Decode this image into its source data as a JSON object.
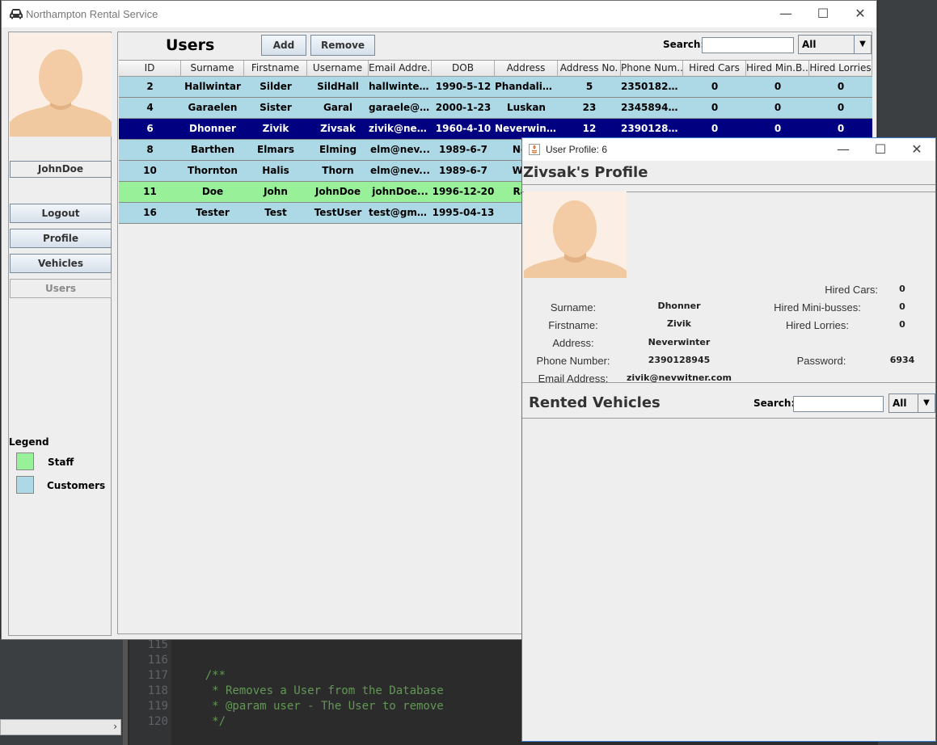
{
  "main_window": {
    "title": "Northampton Rental Service",
    "minimize": "—",
    "maximize": "☐",
    "close": "✕"
  },
  "sidebar": {
    "username": "JohnDoe",
    "buttons": {
      "logout": "Logout",
      "profile": "Profile",
      "vehicles": "Vehicles",
      "users": "Users"
    },
    "legend": {
      "title": "Legend",
      "staff_label": "Staff",
      "staff_color": "#98f098",
      "customers_label": "Customers",
      "customers_color": "#add8e6"
    }
  },
  "users_panel": {
    "title": "Users",
    "add_label": "Add",
    "remove_label": "Remove",
    "search_label": "Search:",
    "search_value": "",
    "filter_value": "All",
    "columns": [
      "ID",
      "Surname",
      "Firstname",
      "Username",
      "Email Addre...",
      "DOB",
      "Address",
      "Address No.",
      "Phone Num...",
      "Hired Cars",
      "Hired Min.B...",
      "Hired Lorries"
    ],
    "rows": [
      {
        "cells": [
          "2",
          "Hallwintar",
          "Silder",
          "SildHall",
          "hallwinter...",
          "1990-5-12",
          "Phandalin St",
          "5",
          "2350182948",
          "0",
          "0",
          "0"
        ],
        "type": "customer",
        "selected": false
      },
      {
        "cells": [
          "4",
          "Garaelen",
          "Sister",
          "Garal",
          "garaele@n...",
          "2000-1-23",
          "Luskan",
          "23",
          "2345894589",
          "0",
          "0",
          "0"
        ],
        "type": "customer",
        "selected": false
      },
      {
        "cells": [
          "6",
          "Dhonner",
          "Zivik",
          "Zivsak",
          "zivik@nev...",
          "1960-4-10",
          "Neverwinter",
          "12",
          "2390128945",
          "0",
          "0",
          "0"
        ],
        "type": "customer",
        "selected": true
      },
      {
        "cells": [
          "8",
          "Barthen",
          "Elmars",
          "Elming",
          "elm@nev...",
          "1989-6-7",
          "Neve",
          "",
          "",
          "",
          "",
          ""
        ],
        "type": "customer",
        "selected": false
      },
      {
        "cells": [
          "10",
          "Thornton",
          "Halis",
          "Thorn",
          "elm@nev...",
          "1989-6-7",
          "Wate",
          "",
          "",
          "",
          "",
          ""
        ],
        "type": "customer",
        "selected": false
      },
      {
        "cells": [
          "11",
          "Doe",
          "John",
          "JohnDoe",
          "johnDoe...",
          "1996-12-20",
          "Ranc",
          "",
          "",
          "",
          "",
          ""
        ],
        "type": "staff",
        "selected": false
      },
      {
        "cells": [
          "16",
          "Tester",
          "Test",
          "TestUser",
          "test@gmai...",
          "1995-04-13",
          "T",
          "",
          "",
          "",
          "",
          ""
        ],
        "type": "customer",
        "selected": false
      }
    ],
    "colors": {
      "customer": "#add8e6",
      "staff": "#98f098",
      "selected": "#000080"
    }
  },
  "profile_window": {
    "title": "User Profile: 6",
    "heading": "Zivsak's Profile",
    "labels": {
      "surname": "Surname:",
      "firstname": "Firstname:",
      "address": "Address:",
      "phone": "Phone Number:",
      "email": "Email Address:",
      "hired_cars": "Hired Cars:",
      "hired_minibusses": "Hired Mini-busses:",
      "hired_lorries": "Hired Lorries:",
      "password": "Password:"
    },
    "values": {
      "surname": "Dhonner",
      "firstname": "Zivik",
      "address": "Neverwinter",
      "phone": "2390128945",
      "email": "zivik@nevwitner.com",
      "hired_cars": "0",
      "hired_minibusses": "0",
      "hired_lorries": "0",
      "password": "6934"
    },
    "rented_heading": "Rented Vehicles",
    "search_label": "Search:",
    "search_value": "",
    "filter_value": "All"
  },
  "ide": {
    "lines": [
      {
        "num": "115",
        "code": ""
      },
      {
        "num": "116",
        "code": ""
      },
      {
        "num": "117",
        "code": "    /**"
      },
      {
        "num": "118",
        "code": "     * Removes a User from the Database"
      },
      {
        "num": "119",
        "code": "     * @param user - The User to remove"
      },
      {
        "num": "120",
        "code": "     */"
      }
    ]
  }
}
